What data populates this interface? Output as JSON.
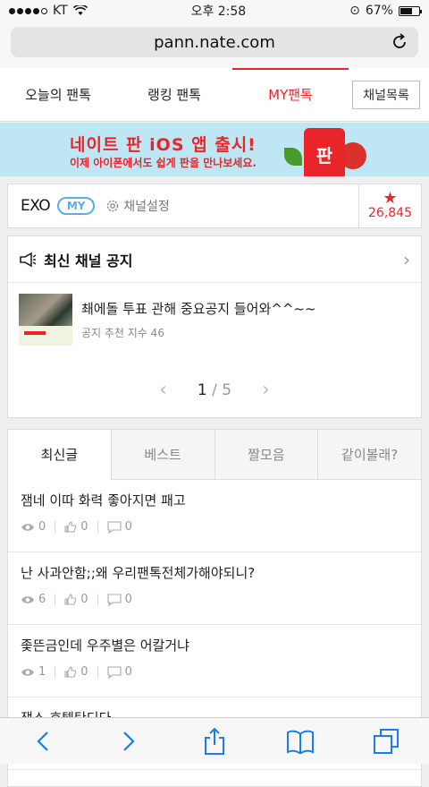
{
  "status": {
    "carrier": "KT",
    "time": "오후 2:58",
    "battery": "67%",
    "battery_level": 0.67
  },
  "browser": {
    "url": "pann.nate.com"
  },
  "nav": {
    "tabs": [
      "오늘의 팬톡",
      "랭킹 팬톡",
      "MY팬톡"
    ],
    "channel_list": "채널목록"
  },
  "banner": {
    "title": "네이트 판 iOS 앱 출시!",
    "subtitle": "이제 아이폰에서도 쉽게 판을 만나보세요.",
    "app_label": "판"
  },
  "channel": {
    "name": "EXO",
    "badge": "MY",
    "settings": "채널설정",
    "star_count": "26,845"
  },
  "notice": {
    "title": "최신 채널 공지",
    "item_title": "쵀에돌 투표 관해 중요공지 들어와^^~~",
    "item_meta": "공지 추천 지수 46",
    "page_current": "1",
    "page_sep": " / ",
    "page_total": "5"
  },
  "subtabs": [
    "최신글",
    "베스트",
    "짤모음",
    "같이볼래?"
  ],
  "posts": [
    {
      "title": "잼네 이따 화력 좋아지면 패고",
      "views": "0",
      "likes": "0",
      "comments": "0"
    },
    {
      "title": "난 사과안함;;왜 우리팬톡전체가해야되니?",
      "views": "6",
      "likes": "0",
      "comments": "0"
    },
    {
      "title": "좇뜬금인데 우주별은 어칼거냐",
      "views": "1",
      "likes": "0",
      "comments": "0"
    },
    {
      "title": "잼스 호텔탄디다",
      "views": "",
      "likes": "",
      "comments": ""
    }
  ],
  "colors": {
    "accent": "#e9252b",
    "badge": "#5aaee8",
    "ios_blue": "#1a7cf5"
  }
}
